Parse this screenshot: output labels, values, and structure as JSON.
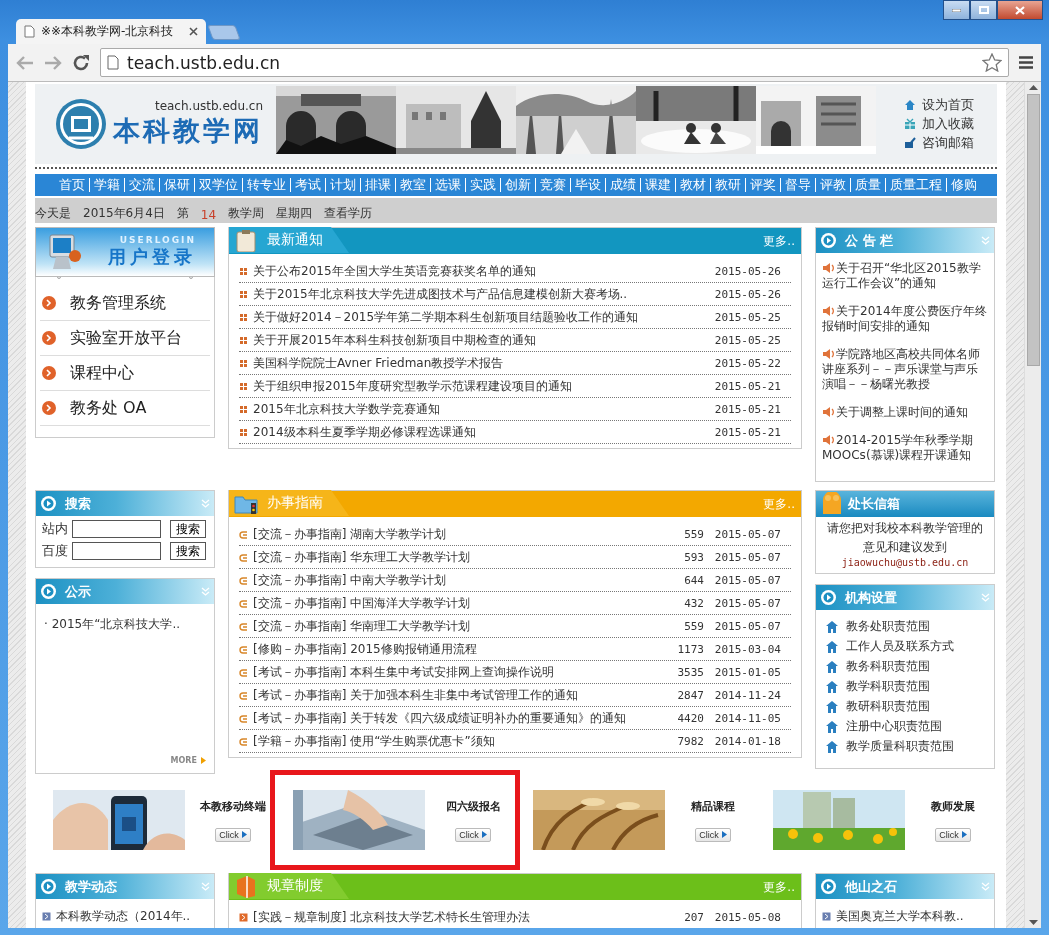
{
  "window": {
    "tab_title": "※※本科教学网-北京科技",
    "address": "teach.ustb.edu.cn"
  },
  "header": {
    "site_url": "teach.ustb.edu.cn",
    "site_name": "本科教学网",
    "links": [
      "设为首页",
      "加入收藏",
      "咨询邮箱"
    ]
  },
  "nav": [
    "首页",
    "学籍",
    "交流",
    "保研",
    "双学位",
    "转专业",
    "考试",
    "计划",
    "排课",
    "教室",
    "选课",
    "实践",
    "创新",
    "竞赛",
    "毕设",
    "成绩",
    "课建",
    "教材",
    "教研",
    "评奖",
    "督导",
    "评教",
    "质量",
    "质量工程",
    "修购"
  ],
  "date_bar": {
    "prefix": "今天是",
    "date": "2015年6月4日",
    "week_prefix": "第",
    "week_number": "14",
    "week_suffix": "教学周",
    "weekday": "星期四",
    "link": "查看学历"
  },
  "login_panel": {
    "caption": "USERLOGIN",
    "title": "用户登录",
    "links": [
      "教务管理系统",
      "实验室开放平台",
      "课程中心",
      "教务处 OA"
    ]
  },
  "latest_notices": {
    "title": "最新通知",
    "more": "更多..",
    "items": [
      {
        "title": "关于公布2015年全国大学生英语竞赛获奖名单的通知",
        "date": "2015-05-26"
      },
      {
        "title": "关于2015年北京科技大学先进成图技术与产品信息建模创新大赛考场..",
        "date": "2015-05-26"
      },
      {
        "title": "关于做好2014－2015学年第二学期本科生创新项目结题验收工作的通知",
        "date": "2015-05-25"
      },
      {
        "title": "关于开展2015年本科生科技创新项目中期检查的通知",
        "date": "2015-05-25"
      },
      {
        "title": "美国科学院院士Avner Friedman教授学术报告",
        "date": "2015-05-22"
      },
      {
        "title": "关于组织申报2015年度研究型教学示范课程建设项目的通知",
        "date": "2015-05-21"
      },
      {
        "title": "2015年北京科技大学数学竞赛通知",
        "date": "2015-05-21"
      },
      {
        "title": "2014级本科生夏季学期必修课程选课通知",
        "date": "2015-05-21"
      }
    ]
  },
  "bulletin": {
    "title": "公 告 栏",
    "items": [
      "关于召开“华北区2015教学运行工作会议”的通知",
      "关于2014年度公费医疗年终报销时间安排的通知",
      "学院路地区高校共同体名师讲座系列－－声乐课堂与声乐演唱－－杨曙光教授",
      "关于调整上课时间的通知",
      "2014-2015学年秋季学期MOOCs(慕课)课程开课通知"
    ]
  },
  "search_panel": {
    "title": "搜索",
    "rows": [
      {
        "label": "站内",
        "button": "搜索"
      },
      {
        "label": "百度",
        "button": "搜索"
      }
    ]
  },
  "announcement": {
    "title": "公示",
    "items": [
      "· 2015年“北京科技大学.."
    ],
    "more": "MORE"
  },
  "guide": {
    "title": "办事指南",
    "more": "更多..",
    "items": [
      {
        "title": "[交流－办事指南] 湖南大学教学计划",
        "views": "559",
        "date": "2015-05-07"
      },
      {
        "title": "[交流－办事指南] 华东理工大学教学计划",
        "views": "593",
        "date": "2015-05-07"
      },
      {
        "title": "[交流－办事指南] 中南大学教学计划",
        "views": "644",
        "date": "2015-05-07"
      },
      {
        "title": "[交流－办事指南] 中国海洋大学教学计划",
        "views": "432",
        "date": "2015-05-07"
      },
      {
        "title": "[交流－办事指南] 华南理工大学教学计划",
        "views": "559",
        "date": "2015-05-07"
      },
      {
        "title": "[修购－办事指南] 2015修购报销通用流程",
        "views": "1173",
        "date": "2015-03-04"
      },
      {
        "title": "[考试－办事指南] 本科生集中考试安排网上查询操作说明",
        "views": "3535",
        "date": "2015-01-05"
      },
      {
        "title": "[考试－办事指南] 关于加强本科生非集中考试管理工作的通知",
        "views": "2847",
        "date": "2014-11-24"
      },
      {
        "title": "[考试－办事指南] 关于转发《四六级成绩证明补办的重要通知》的通知",
        "views": "4420",
        "date": "2014-11-05"
      },
      {
        "title": "[学籍－办事指南] 使用“学生购票优惠卡”须知",
        "views": "7982",
        "date": "2014-01-18"
      }
    ]
  },
  "mailbox": {
    "title": "处长信箱",
    "message": "请您把对我校本科教学管理的意见和建议发到",
    "email": "jiaowuchu@ustb.edu.cn"
  },
  "departments": {
    "title": "机构设置",
    "items": [
      "教务处职责范围",
      "工作人员及联系方式",
      "教务科职责范围",
      "教学科职责范围",
      "教研科职责范围",
      "注册中心职责范围",
      "教学质量科职责范围"
    ]
  },
  "promos": [
    {
      "title": "本教移动终端",
      "button": "Click",
      "highlighted": false
    },
    {
      "title": "四六级报名",
      "button": "Click",
      "highlighted": true
    },
    {
      "title": "精品课程",
      "button": "Click",
      "highlighted": false
    },
    {
      "title": "教师发展",
      "button": "Click",
      "highlighted": false
    }
  ],
  "teaching_news": {
    "title": "教学动态",
    "items": [
      "本科教学动态（2014年.."
    ]
  },
  "regulations": {
    "title": "规章制度",
    "more": "更多..",
    "items": [
      {
        "title": "[实践－规章制度] 北京科技大学艺术特长生管理办法",
        "views": "207",
        "date": "2015-05-08"
      }
    ]
  },
  "other_schools": {
    "title": "他山之石",
    "items": [
      "美国奥克兰大学本科教.."
    ]
  }
}
